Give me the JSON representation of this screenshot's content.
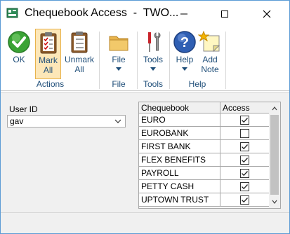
{
  "window": {
    "title": "Chequebook Access  -  TWO..."
  },
  "ribbon": {
    "buttons": {
      "ok": "OK",
      "mark_all": "Mark All",
      "unmark_all": "Unmark All",
      "file": "File",
      "tools": "Tools",
      "help": "Help",
      "add_note": "Add Note"
    },
    "groups": {
      "actions": "Actions",
      "file": "File",
      "tools": "Tools",
      "help": "Help"
    },
    "icons": {
      "ok": "check-circle-icon",
      "mark_all": "clipboard-checklist-icon",
      "unmark_all": "clipboard-icon",
      "file": "folder-icon",
      "tools": "tools-icon",
      "help": "help-circle-icon",
      "add_note": "note-star-icon"
    }
  },
  "form": {
    "user_id_label": "User ID",
    "user_id_value": "gav"
  },
  "grid": {
    "columns": [
      "Chequebook",
      "Access"
    ],
    "rows": [
      {
        "name": "EURO",
        "access": true
      },
      {
        "name": "EUROBANK",
        "access": false
      },
      {
        "name": "FIRST BANK",
        "access": true
      },
      {
        "name": "FLEX BENEFITS",
        "access": true
      },
      {
        "name": "PAYROLL",
        "access": true
      },
      {
        "name": "PETTY CASH",
        "access": true
      },
      {
        "name": "UPTOWN TRUST",
        "access": true
      }
    ]
  },
  "colors": {
    "window_border": "#5b9bd5",
    "ribbon_label": "#1f4e79",
    "selected_fill": "#fde7b8",
    "selected_border": "#e8b34c"
  }
}
